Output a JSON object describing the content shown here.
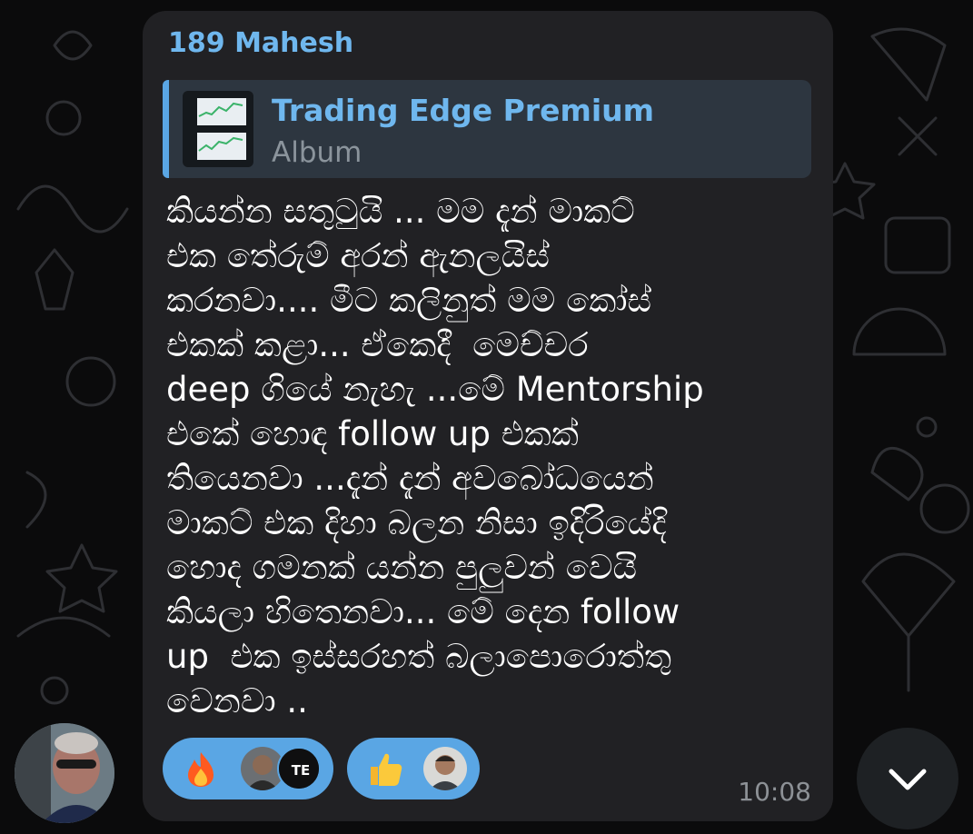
{
  "message": {
    "sender": "189 Mahesh",
    "reply": {
      "title": "Trading Edge Premium",
      "subtitle": "Album",
      "thumb_icon": "chart-thumbnail-icon"
    },
    "text": "කියන්න සතුටුයි ... මම දැන් මාකට්\nඑක තේරුම් අරන් ඇනලයිස්\nකරනවා.... මීට කලිනුත් මම කෝස්\nඑකක් කළා... ඒකෙදී  මෙච්චර\ndeep ගියේ නැහැ ...මේ Mentorship\nඑකේ හොඳ follow up එකක්\nතියෙනවා ...දැන් දැන් අවබෝධයෙන්\nමාකට් එක දිහා බලන නිසා ඉදිරියේදි\nහොද ගමනක් යන්න පුලුවන් වෙයි\nකියලා හිතෙනවා... මේ දෙන follow\nup  එක ඉස්සරහත් බලාපොරොත්තු\nවෙනවා ..",
    "time": "10:08",
    "reactions": [
      {
        "emoji": "fire-icon",
        "avatars": [
          "reactor-avatar",
          "trading-edge-logo"
        ],
        "logo_text": "TE"
      },
      {
        "emoji": "thumbs-up-icon",
        "avatars": [
          "reactor-avatar"
        ]
      }
    ]
  },
  "colors": {
    "background": "#0b0b0c",
    "bubble": "#212124",
    "accent": "#6fb7ee",
    "reaction_pill": "#5aa6e4"
  },
  "controls": {
    "scroll_down_icon": "chevron-down-icon"
  }
}
